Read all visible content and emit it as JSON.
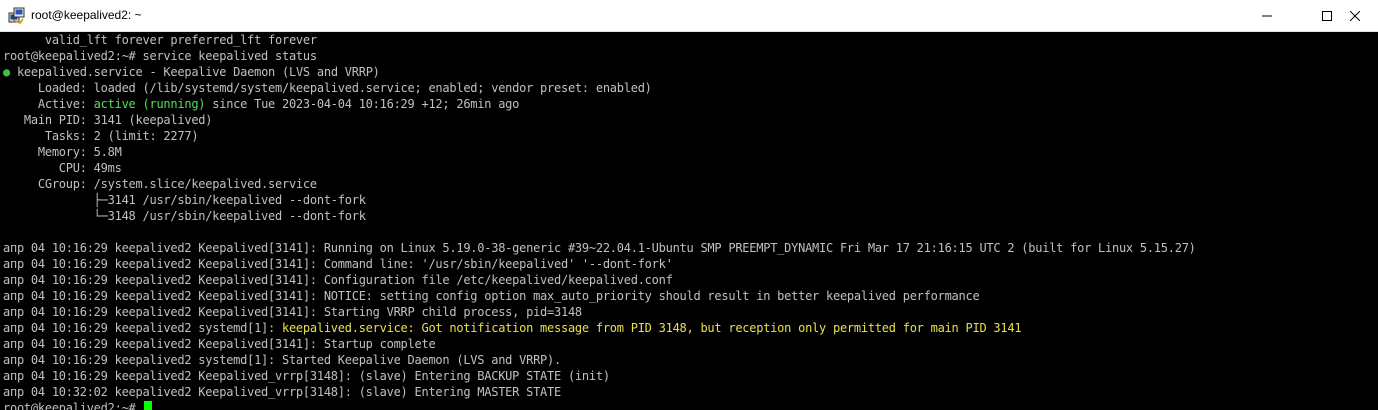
{
  "window": {
    "title": "root@keepalived2: ~",
    "icon": "putty-icon",
    "controls": {
      "minimize": "minimize-icon",
      "maximize": "maximize-icon",
      "close": "close-icon"
    }
  },
  "colors": {
    "background": "#000000",
    "text": "#c0c0c0",
    "active": "#55e055",
    "warning": "#e8e04c",
    "cursor": "#00ff00"
  },
  "terminal": {
    "l0": "      valid_lft forever preferred_lft forever",
    "l1": "root@keepalived2:~# service keepalived status",
    "l2_dot": "●",
    "l2": " keepalived.service - Keepalive Daemon (LVS and VRRP)",
    "l3": "     Loaded: loaded (/lib/systemd/system/keepalived.service; enabled; vendor preset: enabled)",
    "l4_label": "     Active: ",
    "l4_status": "active (running)",
    "l4_rest": " since Tue 2023-04-04 10:16:29 +12; 26min ago",
    "l5": "   Main PID: 3141 (keepalived)",
    "l6": "      Tasks: 2 (limit: 2277)",
    "l7": "     Memory: 5.8M",
    "l8": "        CPU: 49ms",
    "l9": "     CGroup: /system.slice/keepalived.service",
    "l10": "             ├─3141 /usr/sbin/keepalived --dont-fork",
    "l11": "             └─3148 /usr/sbin/keepalived --dont-fork",
    "l12": "",
    "l13": "апр 04 10:16:29 keepalived2 Keepalived[3141]: Running on Linux 5.19.0-38-generic #39~22.04.1-Ubuntu SMP PREEMPT_DYNAMIC Fri Mar 17 21:16:15 UTC 2 (built for Linux 5.15.27)",
    "l14": "апр 04 10:16:29 keepalived2 Keepalived[3141]: Command line: '/usr/sbin/keepalived' '--dont-fork'",
    "l15": "апр 04 10:16:29 keepalived2 Keepalived[3141]: Configuration file /etc/keepalived/keepalived.conf",
    "l16": "апр 04 10:16:29 keepalived2 Keepalived[3141]: NOTICE: setting config option max_auto_priority should result in better keepalived performance",
    "l17": "апр 04 10:16:29 keepalived2 Keepalived[3141]: Starting VRRP child process, pid=3148",
    "l18_pre": "апр 04 10:16:29 keepalived2 systemd[1]: ",
    "l18_warn": "keepalived.service: Got notification message from PID 3148, but reception only permitted for main PID 3141",
    "l19": "апр 04 10:16:29 keepalived2 Keepalived[3141]: Startup complete",
    "l20": "апр 04 10:16:29 keepalived2 systemd[1]: Started Keepalive Daemon (LVS and VRRP).",
    "l21": "апр 04 10:16:29 keepalived2 Keepalived_vrrp[3148]: (slave) Entering BACKUP STATE (init)",
    "l22": "апр 04 10:32:02 keepalived2 Keepalived_vrrp[3148]: (slave) Entering MASTER STATE",
    "l23": "root@keepalived2:~# "
  }
}
